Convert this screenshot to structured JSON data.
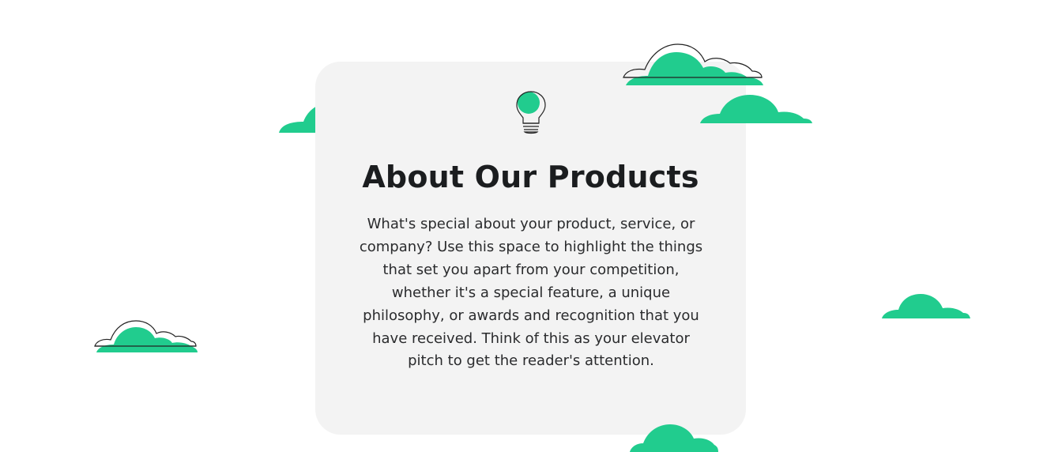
{
  "section": {
    "title": "About Our Products",
    "description": "What's special about your product, service, or company? Use this space to highlight the things that set you apart from your competition, whether it's a special feature, a unique philosophy, or awards and recognition that you have received. Think of this as your elevator pitch to get the reader's attention."
  },
  "icons": {
    "bulb": "lightbulb-icon",
    "cloud": "cloud-icon"
  },
  "colors": {
    "accent": "#21cc8e",
    "card": "#f3f3f3",
    "text": "#1b1d1f",
    "background": "#ffffff"
  }
}
